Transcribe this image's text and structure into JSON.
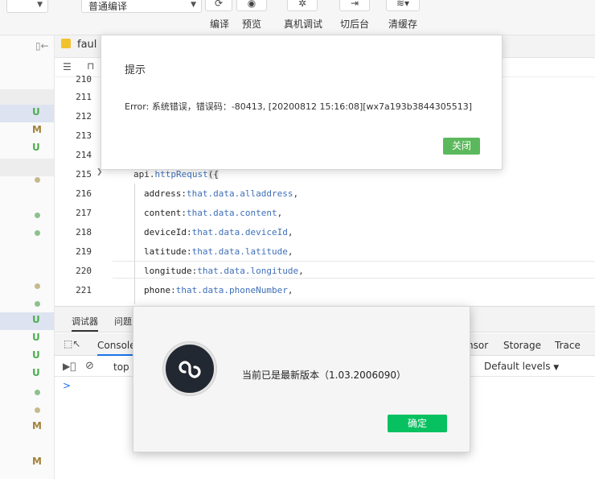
{
  "toolbar": {
    "mode_select": "",
    "compile_select": "普通编译",
    "compile_label": "编译",
    "preview_label": "预览",
    "device_debug_label": "真机调试",
    "background_label": "切后台",
    "clear_cache_label": "清缓存"
  },
  "editor": {
    "tab_filename": "faul",
    "lines": [
      {
        "num": "210"
      },
      {
        "num": "211"
      },
      {
        "num": "212"
      },
      {
        "num": "213"
      },
      {
        "num": "214"
      },
      {
        "num": "215",
        "code_obj": "api",
        "code_method": "httpRequst",
        "code_paren": "({"
      },
      {
        "num": "216",
        "prop": "address",
        "value": "that.data.alladdress"
      },
      {
        "num": "217",
        "prop": "content",
        "value": "that.data.content"
      },
      {
        "num": "218",
        "prop": "deviceId",
        "value": "that.data.deviceId"
      },
      {
        "num": "219",
        "prop": "latitude",
        "value": "that.data.latitude"
      },
      {
        "num": "220",
        "prop": "longitude",
        "value": "that.data.longitude"
      },
      {
        "num": "221",
        "prop": "phone",
        "value": "that.data.phoneNumber"
      }
    ]
  },
  "git_status": [
    "U",
    "M",
    "U",
    "U",
    "U",
    "U",
    "U",
    "M",
    "M"
  ],
  "colors": {
    "untracked": "#4caf50",
    "modified": "#a1813a",
    "dot_green": "#8fc08f",
    "dot_olive": "#c7b98c",
    "wechat_green": "#07c160"
  },
  "debugger": {
    "tab_debugger": "调试器",
    "tab_issues": "问题",
    "tab_console": "Console",
    "tab_sensor": "nsor",
    "tab_storage": "Storage",
    "tab_trace": "Trace",
    "context": "top",
    "levels": "Default levels",
    "prompt": ">"
  },
  "error_dialog": {
    "title": "提示",
    "message": "Error: 系统错误，错误码：-80413, [20200812 15:16:08][wx7a193b3844305513]",
    "close_label": "关闭"
  },
  "update_dialog": {
    "message": "当前已是最新版本（1.03.2006090）",
    "ok_label": "确定"
  }
}
